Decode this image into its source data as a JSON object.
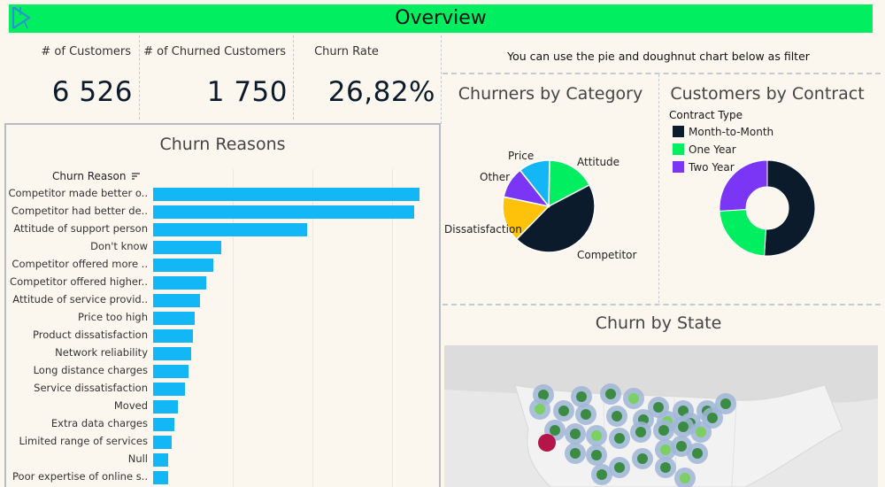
{
  "header": {
    "title": "Overview"
  },
  "kpis": [
    {
      "label": "# of Customers",
      "value": "6 526"
    },
    {
      "label": "# of Churned Customers",
      "value": "1 750"
    },
    {
      "label": "Churn Rate",
      "value": "26,82%"
    }
  ],
  "filter_note": "You can use the pie and doughnut chart below as filter",
  "reasons_chart": {
    "title": "Churn Reasons",
    "field_header": "Churn Reason",
    "chart_data": {
      "type": "bar",
      "orientation": "horizontal",
      "categories": [
        "Competitor made better o..",
        "Competitor had better de..",
        "Attitude of support person",
        "Don't know",
        "Competitor offered more ..",
        "Competitor offered higher..",
        "Attitude of service provid..",
        "Price too high",
        "Product dissatisfaction",
        "Network reliability",
        "Long distance charges",
        "Service dissatisfaction",
        "Moved",
        "Extra data charges",
        "Limited range of services",
        "Null",
        "Poor expertise of online s.."
      ],
      "values": [
        311,
        304,
        180,
        79,
        70,
        62,
        55,
        48,
        46,
        44,
        41,
        37,
        29,
        25,
        22,
        18,
        18
      ],
      "xlim": [
        0,
        320
      ],
      "bar_color": "#13b7f6"
    }
  },
  "category_chart": {
    "title": "Churners by Category",
    "chart_data": {
      "type": "pie",
      "labels": [
        "Competitor",
        "Attitude",
        "Price",
        "Other",
        "Dissatisfaction"
      ],
      "values": [
        45,
        17,
        11,
        11,
        16
      ],
      "colors": [
        "#0c1b2c",
        "#00ee5f",
        "#13b7f6",
        "#7a35f5",
        "#ffc20a"
      ],
      "highlight": {
        "label": "Other",
        "values_between_slices": []
      }
    }
  },
  "contract_chart": {
    "title": "Customers by Contract",
    "legend_title": "Contract Type",
    "chart_data": {
      "type": "pie",
      "donut": true,
      "labels": [
        "Month-to-Month",
        "One Year",
        "Two Year"
      ],
      "values": [
        51,
        23,
        26
      ],
      "colors": [
        "#0c1b2c",
        "#00ee5f",
        "#7a35f5"
      ]
    }
  },
  "state_chart": {
    "title": "Churn by State"
  },
  "icons": {
    "logo": "tableau-logo-icon",
    "sort": "sort-descending-icon"
  }
}
